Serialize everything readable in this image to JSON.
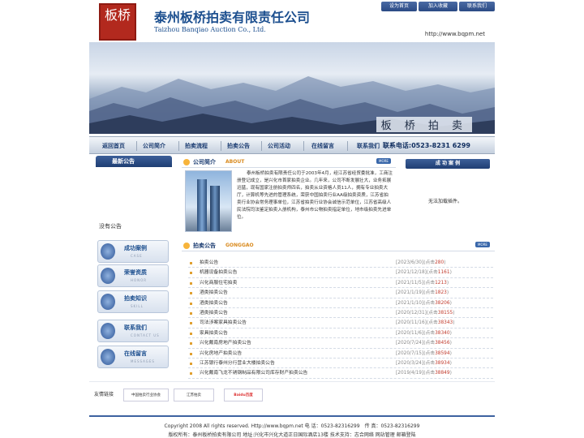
{
  "header": {
    "logo_seal_text": "板桥",
    "company_cn": "泰州板桥拍卖有限责任公司",
    "company_en": "Taizhou Banqiao Auction Co., Ltd.",
    "top_links": [
      "设为首页",
      "加入收藏",
      "联系我们"
    ],
    "url": "http://www.bqpm.net"
  },
  "banner": {
    "caption": "板 桥 拍 卖"
  },
  "nav": {
    "items": [
      "返回首页",
      "公司简介",
      "拍卖流程",
      "拍卖公告",
      "公司活动",
      "在线留言",
      "联系我们"
    ],
    "phone": "联系电话:0523-8231 6299"
  },
  "left": {
    "title": "最新公告",
    "empty_text": "没有公告",
    "buttons": [
      {
        "cn": "成功案例",
        "en": "CASE"
      },
      {
        "cn": "荣誉资质",
        "en": "HONOR"
      },
      {
        "cn": "拍卖知识",
        "en": "SKILL"
      },
      {
        "cn": "联系我们",
        "en": "CONTACT US"
      },
      {
        "cn": "在线留言",
        "en": "MESSAGES"
      }
    ]
  },
  "about": {
    "title_cn": "公司简介",
    "title_en": "ABOUT",
    "more": "MORE",
    "text": "泰州板桥拍卖有限责任公司于2003年4月，经江苏省经贸委批准，工商注册登记成立，是兴化市首家拍卖企业。几年来，公司不断发展壮大，业务拓展迅猛，现有国家注册拍卖师四名，拍卖从业资格人员11人，拥有专业拍卖大厅，计算机等先进的管理系统，荣获中国拍卖行业AA级拍卖资质，江苏省拍卖行业协会常务理事单位，江苏省拍卖行业协会诚信示范单位，江苏省高级人民法院司法鉴定拍卖入册机构，泰州市公物拍卖指定单位，地市级拍卖先进单位。"
  },
  "auction": {
    "title_cn": "拍卖公告",
    "title_en": "GONGGAO",
    "more": "MORE",
    "rows": [
      {
        "title": "拍卖公告",
        "date": "[2023/6/30]",
        "hits": "280"
      },
      {
        "title": "机器设备拍卖公告",
        "date": "[2021/12/18]",
        "hits": "1161"
      },
      {
        "title": "兴化商服住宅拍卖",
        "date": "[2021/11/5]",
        "hits": "1213"
      },
      {
        "title": "酒类拍卖公告",
        "date": "[2021/1/19]",
        "hits": "1823"
      },
      {
        "title": "酒类拍卖公告",
        "date": "[2021/1/10]",
        "hits": "38206"
      },
      {
        "title": "酒类拍卖公告",
        "date": "[2020/12/31]",
        "hits": "38155"
      },
      {
        "title": "司法涉案家具拍卖公告",
        "date": "[2020/11/16]",
        "hits": "38343"
      },
      {
        "title": "家具拍卖公告",
        "date": "[2020/11/6]",
        "hits": "38340"
      },
      {
        "title": "兴化戴南房地产拍卖公告",
        "date": "[2020/7/24]",
        "hits": "38456"
      },
      {
        "title": "兴化房地产拍卖公告",
        "date": "[2020/7/15]",
        "hits": "38594"
      },
      {
        "title": "江苏银行泰州分行营业大楼拍卖公告",
        "date": "[2020/3/24]",
        "hits": "38934"
      },
      {
        "title": "兴化戴南飞龙不锈钢制品有限公司库存财产拍卖公告",
        "date": "[2019/4/19]",
        "hits": "38849"
      }
    ],
    "hits_prefix": "(点击",
    "hits_suffix": ")"
  },
  "right": {
    "title": "成 功 案 例",
    "note": "无法加载插件。"
  },
  "links": {
    "label": "友情链接",
    "items": [
      "中国拍卖行业协会",
      "江苏拍卖",
      "Baidu百度"
    ]
  },
  "footer": {
    "line1": "Copyright 2008 All rights reserved. Http://www.bqpm.net 电 话：0523-82316299　传 真：0523-82316299",
    "line2": "版权所有：泰州板桥拍卖有限公司 地址:兴化市兴化大道正日国际酒店13楼 技术支持：志合网络 网站管理 邮箱登陆"
  },
  "colors": {
    "brand_blue": "#1c4f8f",
    "nav_blue": "#1c3d72",
    "accent_orange": "#d98a1e",
    "seal_red": "#b2291e"
  }
}
